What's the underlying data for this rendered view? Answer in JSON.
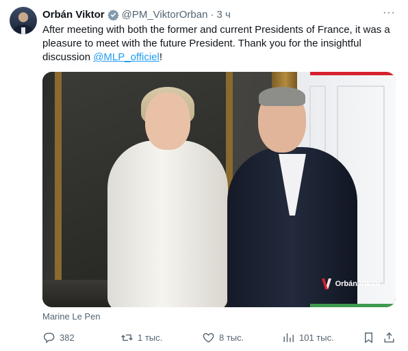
{
  "author": {
    "name": "Orbán Viktor",
    "handle": "@PM_ViktorOrban",
    "separator": "·",
    "time": "3 ч"
  },
  "more_label": "···",
  "tweet": {
    "text_before": "After meeting with both the former and current Presidents of France, it was a pleasure to meet with the future President. Thank you for the insightful discussion ",
    "mention": "@MLP_officiel",
    "text_after": "!"
  },
  "media": {
    "watermark": "Orbán Viktor",
    "accent_top": "#d6222f",
    "accent_bottom": "#3e9b4e"
  },
  "caption": "Marine Le Pen",
  "actions": {
    "replies": "382",
    "reposts": "1 тыс.",
    "likes": "8 тыс.",
    "views": "101 тыс."
  },
  "colors": {
    "text": "#0f1419",
    "secondary": "#536471",
    "link": "#1d9bf0",
    "verified": "#829aab"
  }
}
